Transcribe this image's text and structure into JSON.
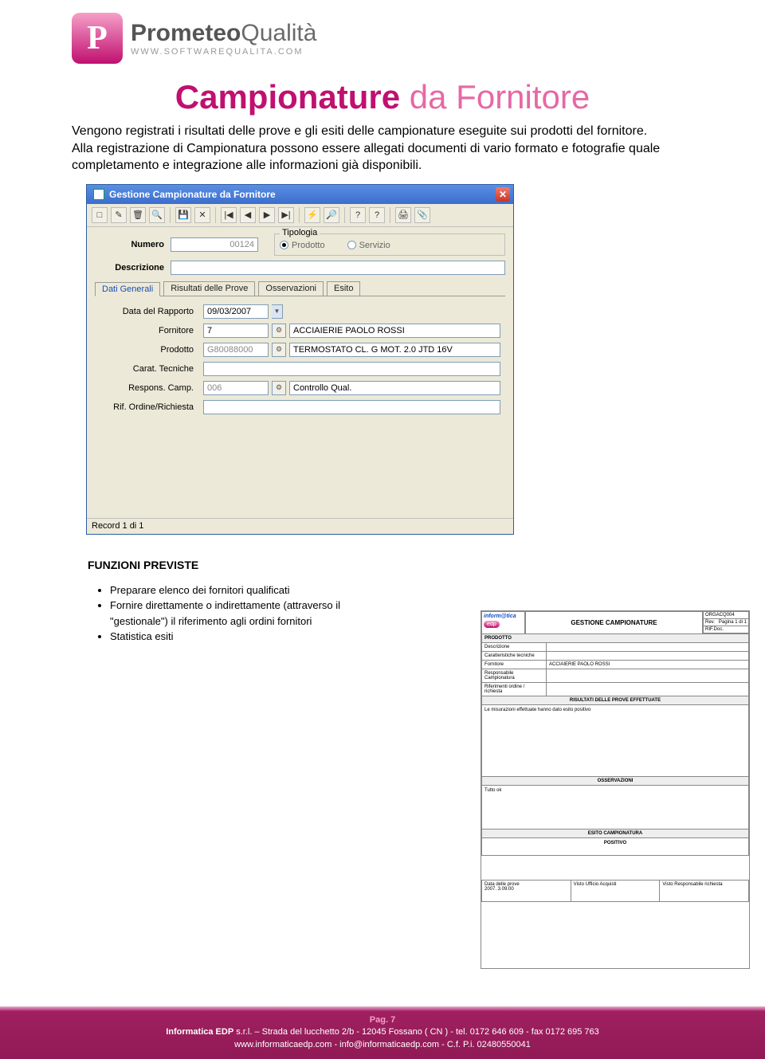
{
  "logo": {
    "brand_strong": "Prometeo",
    "brand_light": "Qualità",
    "url": "WWW.SOFTWAREQUALITA.COM"
  },
  "title": {
    "strong": "Campionature",
    "light": "da Fornitore"
  },
  "intro": "Vengono registrati i risultati delle prove e gli esiti delle campionature eseguite sui prodotti del fornitore.\nAlla registrazione di Campionatura possono essere allegati documenti di vario formato e fotografie quale completamento e integrazione alle informazioni già disponibili.",
  "window": {
    "title": "Gestione Campionature da Fornitore",
    "toolbar_icons": [
      "□",
      "✎",
      "🗑",
      "🔎",
      "",
      "💾",
      "✕",
      "",
      "|◀",
      "◀",
      "▶",
      "▶|",
      "",
      "⚡",
      "🔍",
      "",
      "❓",
      "?",
      "",
      "🖨",
      "📎"
    ],
    "numero_label": "Numero",
    "numero_value": "00124",
    "tipologia_legend": "Tipologia",
    "radio_prodotto": "Prodotto",
    "radio_servizio": "Servizio",
    "descr_label": "Descrizione",
    "tabs": [
      "Dati Generali",
      "Risultati delle Prove",
      "Osservazioni",
      "Esito"
    ],
    "fields": {
      "data_label": "Data del Rapporto",
      "data_val": "09/03/2007",
      "forn_label": "Fornitore",
      "forn_code": "7",
      "forn_name": "ACCIAIERIE PAOLO ROSSI",
      "prod_label": "Prodotto",
      "prod_code": "G80088000",
      "prod_name": "TERMOSTATO CL. G MOT. 2.0 JTD 16V",
      "carat_label": "Carat. Tecniche",
      "resp_label": "Respons. Camp.",
      "resp_code": "006",
      "resp_name": "Controllo Qual.",
      "rif_label": "Rif. Ordine/Richiesta"
    },
    "status": "Record 1 di 1"
  },
  "funzioni": {
    "title": "FUNZIONI PREVISTE",
    "items": [
      "Preparare elenco dei fornitori qualificati",
      "Fornire direttamente o indirettamente (attraverso il \"gestionale\") il riferimento agli ordini fornitori",
      "Statistica esiti"
    ]
  },
  "report": {
    "logo1": "inform@tica",
    "logo2": "edp",
    "title": "GESTIONE CAMPIONATURE",
    "meta1": "ORGACQ004",
    "meta2": "Rev.",
    "meta3": "Pagina 1 di 1",
    "meta4": "RIF.Doc.",
    "sec_prodotto": "PRODOTTO",
    "r1": "Descrizione",
    "r2": "Caratteristiche tecniche",
    "r3": "Fornitore",
    "r3v": "ACCIAIERIE PAOLO ROSSI",
    "r4": "Responsabile Campionatura",
    "r5": "Riferimenti ordine / richiesta",
    "sec_risultati": "RISULTATI DELLE PROVE EFFETTUATE",
    "risultati_text": "Le misurazioni effettuate hanno dato esito positivo",
    "sec_osserv": "OSSERVAZIONI",
    "osserv_text": "Tutto ok",
    "sec_esito": "ESITO CAMPIONATURA",
    "esito_val": "POSITIVO",
    "sign1a": "Data delle prove",
    "sign1b": "2007. 3.09.00",
    "sign2": "Visto Ufficio Acquisti",
    "sign3": "Visto Responsabile richiesta"
  },
  "footer": {
    "pag": "Pag. 7",
    "line1a": "Informatica EDP",
    "line1b": " s.r.l. – Strada del lucchetto 2/b - 12045 Fossano ( CN ) - tel. 0172 646 609 - fax 0172 695 763",
    "line2": "www.informaticaedp.com - info@informaticaedp.com - C.f. P.i. 02480550041"
  }
}
